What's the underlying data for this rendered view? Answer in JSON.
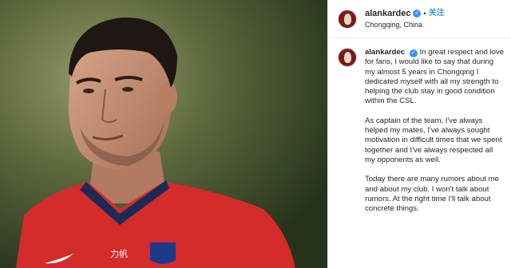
{
  "post": {
    "username": "alankardec",
    "follow_label": "关注",
    "separator": "•",
    "location": "Chongqing, China",
    "verified_icon": "verified-badge-icon",
    "caption": {
      "username": "alankardec",
      "p1": "In great respect and love for fans, I would like to say that during my almost 5 years in Chongqing I dedicated myself with all my strength to helping the club stay in good condition within the CSL.",
      "p2": "As captain of the team, I've always helped my mates, I've always sought motivation in difficult times that we spent together and I've always respected all my opponents as well.",
      "p3": "Today there are many rumors about me and about my club. I won't talk about rumors. At the right time I'll talk about concrete things."
    }
  },
  "photo": {
    "jersey_text": "力帆",
    "colors": {
      "jersey": "#d42b2b",
      "background": "#4b5a33",
      "accent": "#3897f0"
    }
  }
}
